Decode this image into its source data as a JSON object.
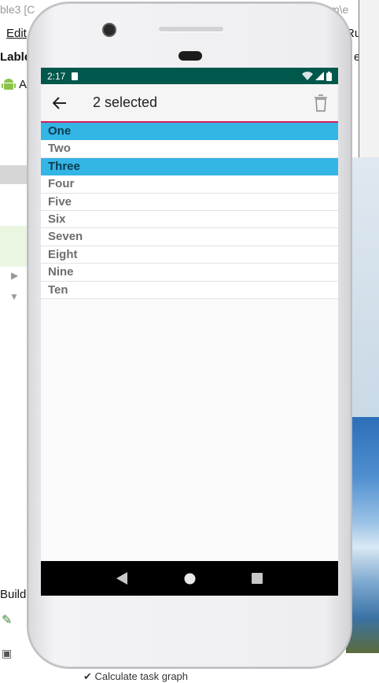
{
  "ide": {
    "title_left": "ble3 [C",
    "title_right": "m\\e",
    "minimize": "–",
    "menu_edit": "Edit",
    "menu_right": "Ru",
    "project_label": "Lable",
    "project_right": "e",
    "android_label": "A",
    "build_label": "Build",
    "status_text": "✔ Calculate task graph"
  },
  "phone": {
    "status_bar": {
      "time": "2:17",
      "bg_color": "#00574b"
    },
    "toolbar": {
      "title": "2 selected",
      "accent_color": "#d81b60"
    },
    "list": {
      "items": [
        {
          "label": "One",
          "selected": true
        },
        {
          "label": "Two",
          "selected": false
        },
        {
          "label": "Three",
          "selected": true
        },
        {
          "label": "Four",
          "selected": false
        },
        {
          "label": "Five",
          "selected": false
        },
        {
          "label": "Six",
          "selected": false
        },
        {
          "label": "Seven",
          "selected": false
        },
        {
          "label": "Eight",
          "selected": false
        },
        {
          "label": "Nine",
          "selected": false
        },
        {
          "label": "Ten",
          "selected": false
        }
      ],
      "selected_color": "#33b5e5"
    },
    "nav_bar": {
      "buttons": [
        "back-icon",
        "home-icon",
        "recents-icon"
      ]
    }
  }
}
